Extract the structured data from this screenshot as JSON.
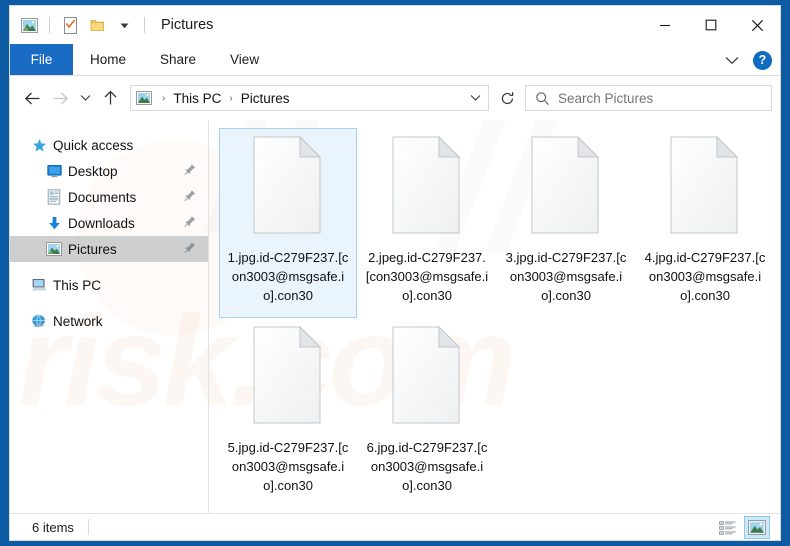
{
  "window": {
    "title": "Pictures",
    "quick_access_icons": [
      "picture-icon",
      "properties-checklist-icon",
      "new-folder-icon",
      "customize-chevron-icon"
    ],
    "controls": {
      "minimize": "minimize-icon",
      "maximize": "maximize-icon",
      "close": "close-icon"
    }
  },
  "ribbon": {
    "file_tab": "File",
    "tabs": [
      "Home",
      "Share",
      "View"
    ],
    "expand_icon": "chevron-down-icon",
    "help_label": "?"
  },
  "addressbar": {
    "back_icon": "arrow-left-icon",
    "forward_icon": "arrow-right-icon",
    "recent_icon": "chevron-down-icon",
    "up_icon": "arrow-up-icon",
    "path_icon": "picture-icon",
    "breadcrumbs": [
      "This PC",
      "Pictures"
    ],
    "separator": "›",
    "dropdown_icon": "chevron-down-icon",
    "refresh_icon": "refresh-icon"
  },
  "search": {
    "icon": "search-icon",
    "placeholder": "Search Pictures",
    "value": ""
  },
  "sidebar": {
    "items": [
      {
        "label": "Quick access",
        "icon": "star-icon",
        "level": "root",
        "pinned": false,
        "selected": false
      },
      {
        "label": "Desktop",
        "icon": "desktop-icon",
        "level": "child",
        "pinned": true,
        "selected": false
      },
      {
        "label": "Documents",
        "icon": "documents-icon",
        "level": "child",
        "pinned": true,
        "selected": false
      },
      {
        "label": "Downloads",
        "icon": "downloads-icon",
        "level": "child",
        "pinned": true,
        "selected": false
      },
      {
        "label": "Pictures",
        "icon": "picture-icon",
        "level": "child",
        "pinned": true,
        "selected": true
      },
      {
        "label": "This PC",
        "icon": "this-pc-icon",
        "level": "root",
        "pinned": false,
        "selected": false
      },
      {
        "label": "Network",
        "icon": "network-icon",
        "level": "root",
        "pinned": false,
        "selected": false
      }
    ]
  },
  "files": [
    {
      "name": "1.jpg.id-C279F237.[con3003@msgsafe.io].con30",
      "icon": "blank-file-icon",
      "selected": true
    },
    {
      "name": "2.jpeg.id-C279F237.[con3003@msgsafe.io].con30",
      "icon": "blank-file-icon",
      "selected": false
    },
    {
      "name": "3.jpg.id-C279F237.[con3003@msgsafe.io].con30",
      "icon": "blank-file-icon",
      "selected": false
    },
    {
      "name": "4.jpg.id-C279F237.[con3003@msgsafe.io].con30",
      "icon": "blank-file-icon",
      "selected": false
    },
    {
      "name": "5.jpg.id-C279F237.[con3003@msgsafe.io].con30",
      "icon": "blank-file-icon",
      "selected": false
    },
    {
      "name": "6.jpg.id-C279F237.[con3003@msgsafe.io].con30",
      "icon": "blank-file-icon",
      "selected": false
    }
  ],
  "statusbar": {
    "item_count": "6 items",
    "views": [
      {
        "name": "details-view-button",
        "icon": "details-list-icon",
        "active": false
      },
      {
        "name": "large-icons-view-button",
        "icon": "large-icons-picture-icon",
        "active": true
      }
    ]
  },
  "watermark": {
    "text": "risk.com"
  },
  "colors": {
    "window_border": "#0c5ba3",
    "file_tab": "#1a6bc4",
    "selection_fill": "#e9f4fd",
    "selection_border": "#a7d3f2",
    "sidebar_selected": "#cfcfcf",
    "help_button": "#0d6cbf"
  }
}
